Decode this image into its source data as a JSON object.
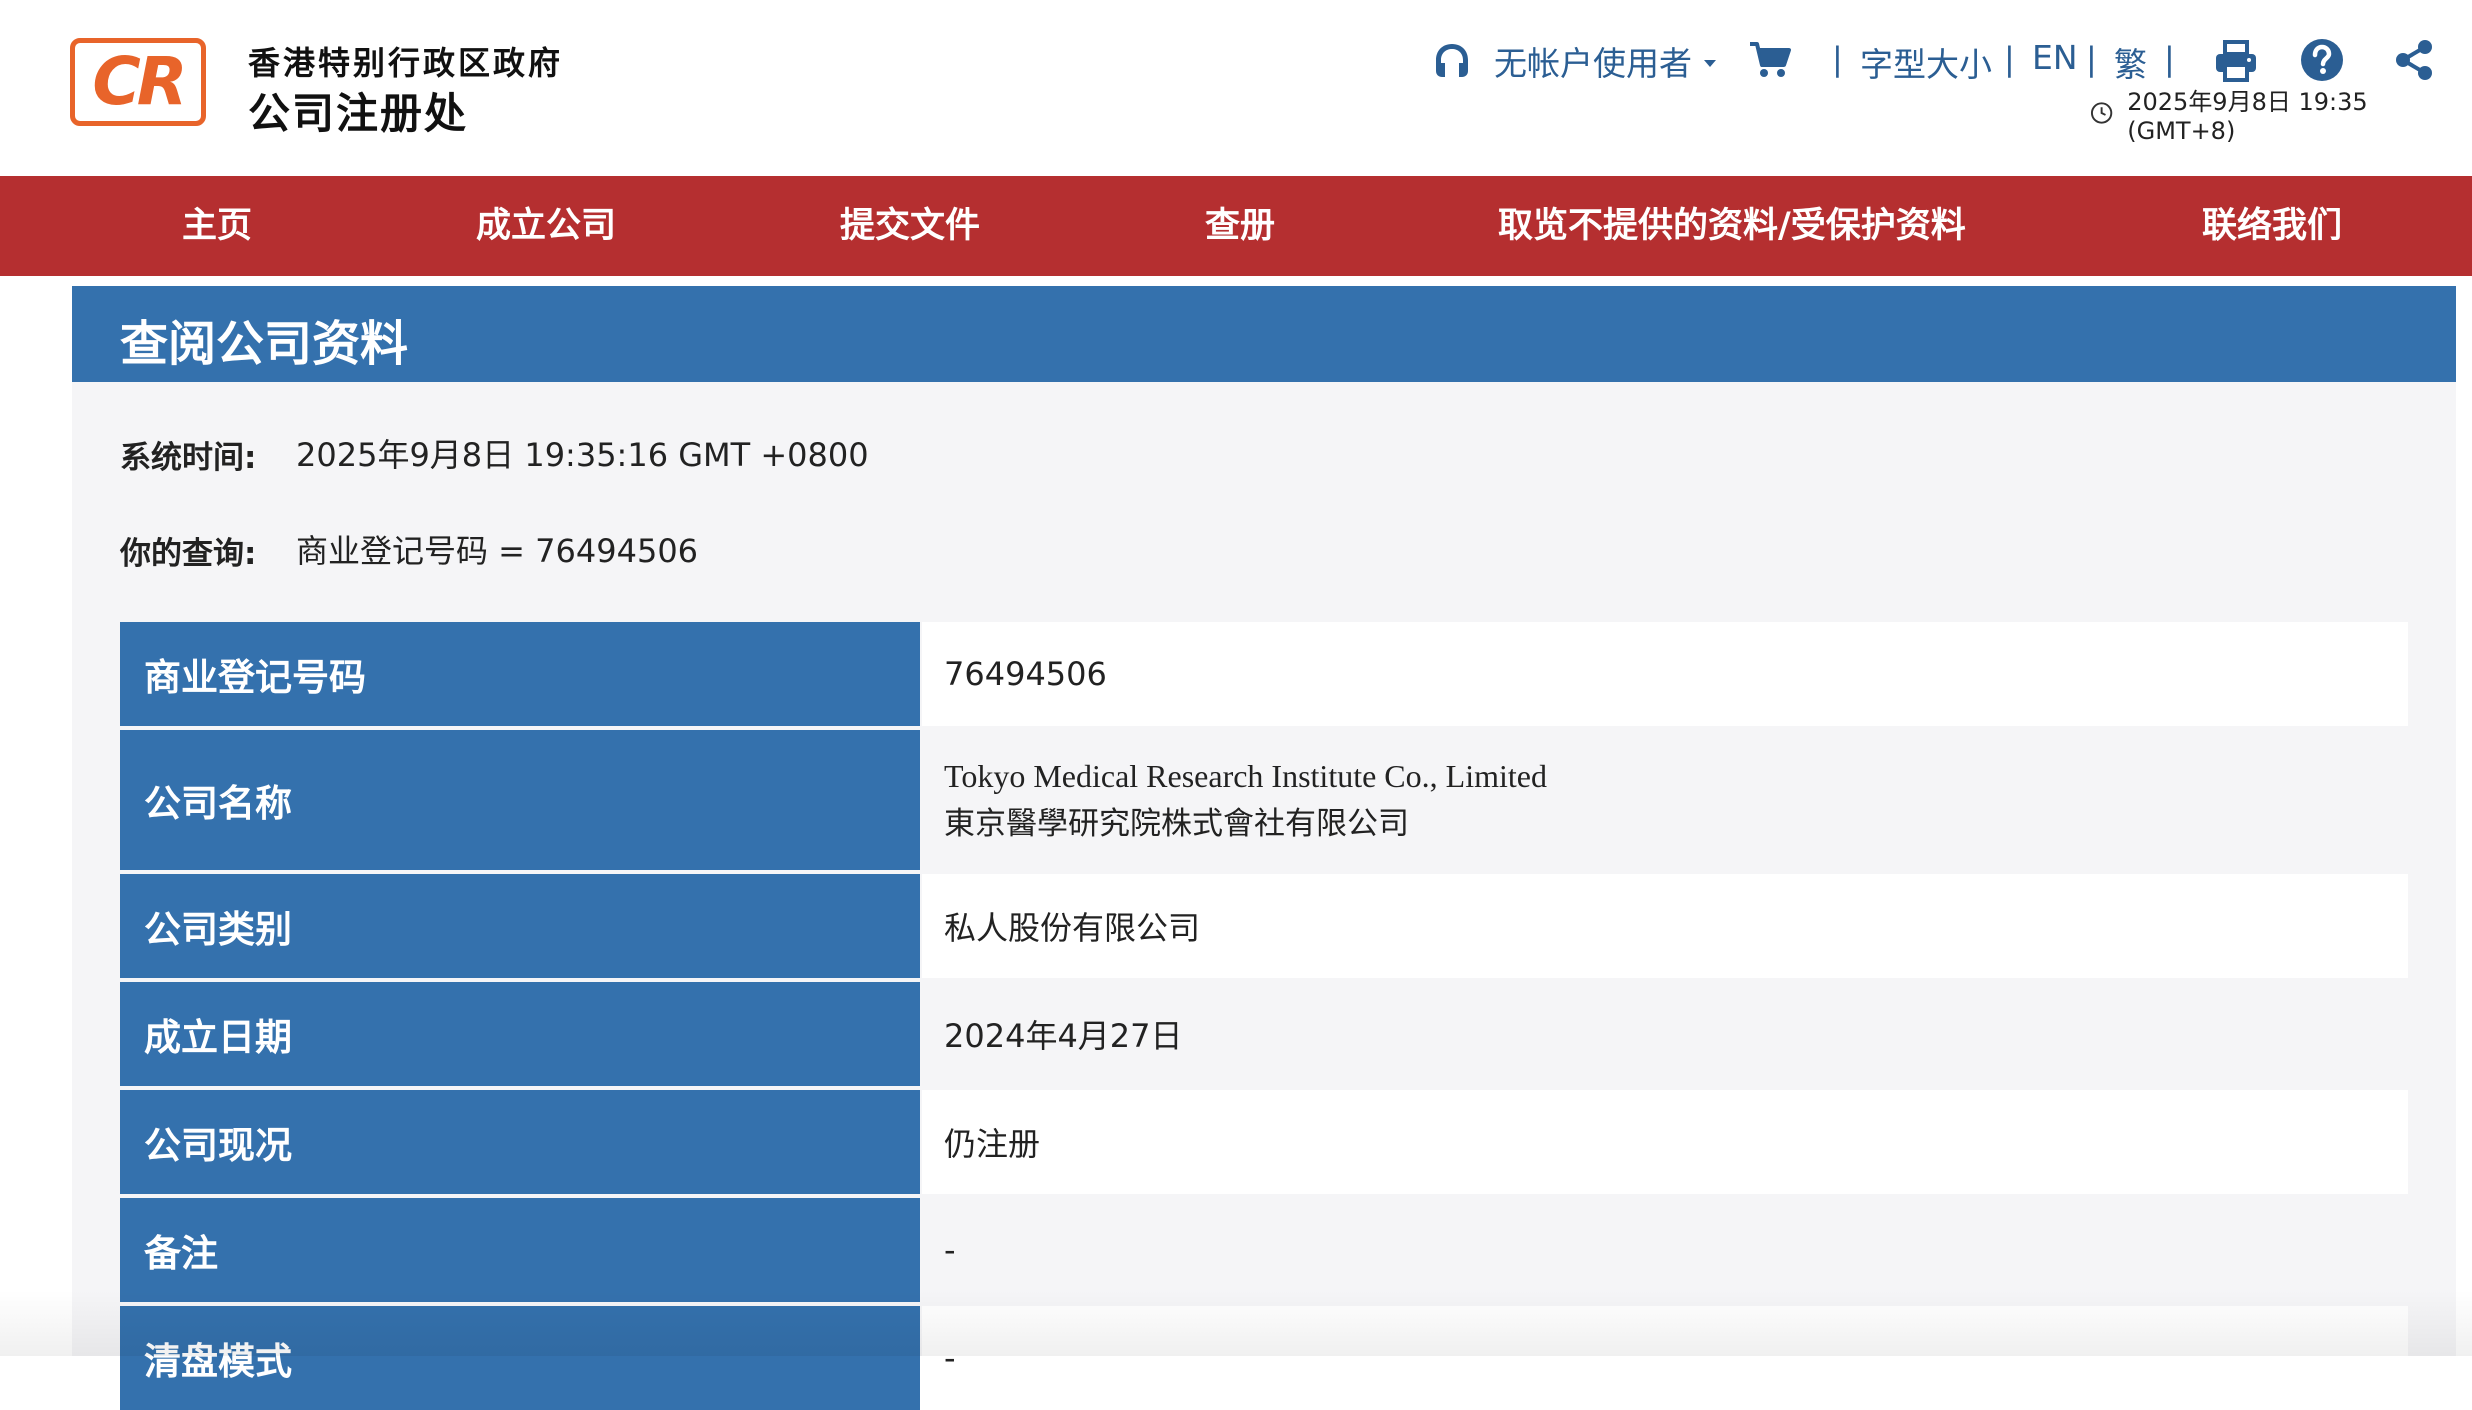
{
  "header": {
    "logo_text": "CR",
    "logo_line1": "香港特别行政区政府",
    "logo_line2": "公司注册处",
    "user_label": "无帐户使用者",
    "font_size_label": "字型大小",
    "lang_en": "EN",
    "lang_trad": "繁",
    "datetime": "2025年9月8日 19:35 (GMT+8)",
    "separator": "|",
    "icons": [
      "user-icon",
      "cart-icon",
      "print-icon",
      "help-icon",
      "share-icon",
      "clock-icon"
    ]
  },
  "nav": {
    "items": [
      "主页",
      "成立公司",
      "提交文件",
      "查册",
      "取览不提供的资料/受保护资料",
      "联络我们"
    ]
  },
  "main": {
    "title": "查阅公司资料",
    "system_time_label": "系统时间:",
    "system_time_value": "2025年9月8日 19:35:16 GMT +0800",
    "query_label": "你的查询:",
    "query_value": "商业登记号码 = 76494506",
    "rows": [
      {
        "label": "商业登记号码",
        "value": "76494506"
      },
      {
        "label": "公司名称",
        "value_en": "Tokyo Medical Research Institute Co., Limited",
        "value_zh": "東京醫學研究院株式會社有限公司"
      },
      {
        "label": "公司类别",
        "value": "私人股份有限公司"
      },
      {
        "label": "成立日期",
        "value": "2024年4月27日"
      },
      {
        "label": "公司现况",
        "value": "仍注册"
      },
      {
        "label": "备注",
        "value": "-"
      },
      {
        "label": "清盘模式",
        "value": "-"
      }
    ]
  },
  "colors": {
    "brand_orange": "#e8642a",
    "nav_red": "#b52f30",
    "header_blue": "#3471ad",
    "link_blue": "#2b5e93"
  }
}
